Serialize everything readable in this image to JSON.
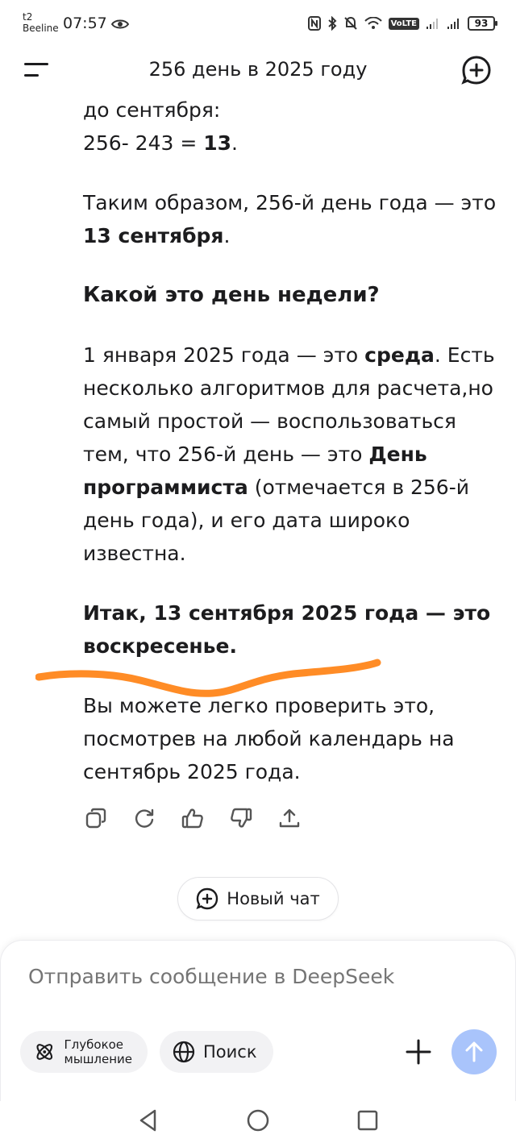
{
  "status": {
    "carrier_top": "t2",
    "carrier_bottom": "Beeline",
    "time": "07:57",
    "volte": "VoLTE",
    "battery": "93"
  },
  "header": {
    "title": "256 день в 2025 году"
  },
  "message": {
    "line1": "до сентября:",
    "calc_prefix": "256- 243 = ",
    "calc_result": "13",
    "calc_suffix": ".",
    "p2_prefix": "Таким образом, 256-й день года — это ",
    "p2_bold": "13 сентября",
    "p2_suffix": ".",
    "heading": "Какой это день недели?",
    "p3_prefix": "1 января 2025 года — это ",
    "p3_bold1": "среда",
    "p3_mid": ". Есть несколько алгоритмов для расчета,но самый простой — воспользоваться тем, что 256-й день — это ",
    "p3_bold2": "День программиста",
    "p3_suffix": " (отмечается в 256-й день года), и его дата широко известна.",
    "conclusion": "Итак, 13 сентября 2025 года — это воскресенье.",
    "p5": "Вы можете легко проверить это, посмотрев на любой календарь на сентябрь 2025 года."
  },
  "actions": [
    "copy-icon",
    "regenerate-icon",
    "thumbs-up-icon",
    "thumbs-down-icon",
    "share-icon"
  ],
  "new_chat": {
    "label": "Новый чат"
  },
  "composer": {
    "placeholder": "Отправить сообщение в DeepSeek",
    "deep_think_label": "Глубокое мышление",
    "search_label": "Поиск",
    "send_color": "#a9c4fb"
  },
  "colors": {
    "highlight_stroke": "#ff8c26",
    "text": "#1c1c1e"
  }
}
